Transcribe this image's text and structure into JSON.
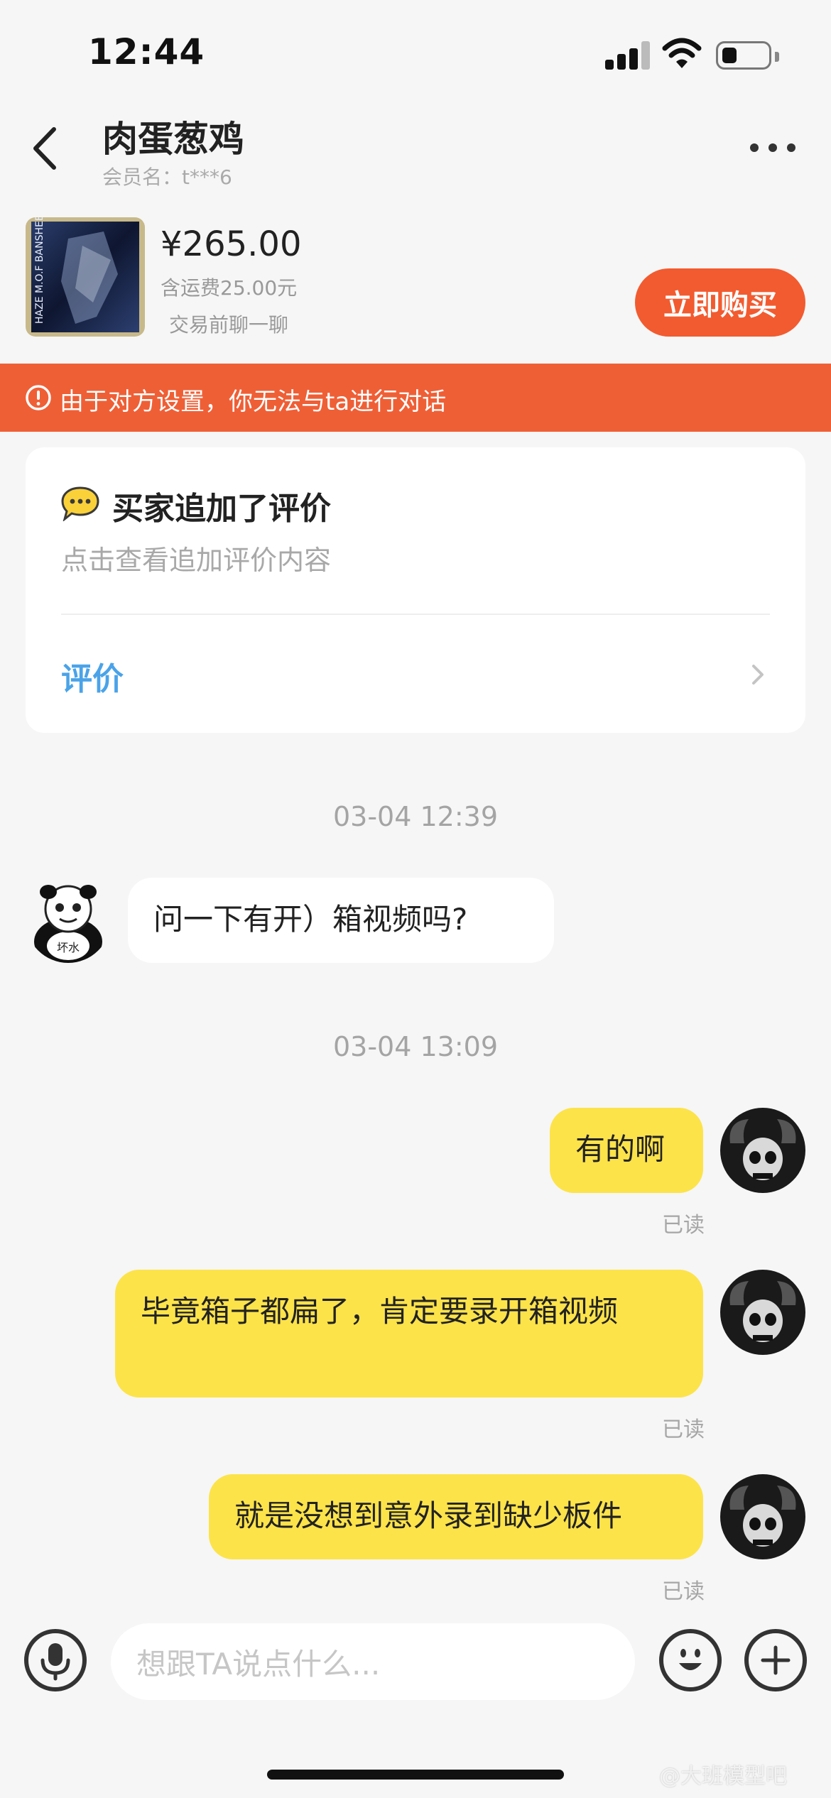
{
  "status_bar": {
    "time": "12:44"
  },
  "header": {
    "title": "肉蛋葱鸡",
    "member_label": "会员名：t***6"
  },
  "product": {
    "price": "¥265.00",
    "shipping": "含运费25.00元",
    "prechat": "交易前聊一聊",
    "buy_label": "立即购买",
    "thumbnail_text": "HAZE M.O.F BANSHEE UNICORN"
  },
  "warning": {
    "text": "由于对方设置，你无法与ta进行对话"
  },
  "review_card": {
    "title": "买家追加了评价",
    "subtitle": "点击查看追加评价内容",
    "link_label": "评价"
  },
  "chat": {
    "timestamps": [
      "03-04 12:39",
      "03-04 13:09"
    ],
    "messages": [
      {
        "side": "left",
        "text": "问一下有开）箱视频吗?"
      },
      {
        "side": "right",
        "text": "有的啊",
        "status": "已读"
      },
      {
        "side": "right",
        "text": "毕竟箱子都扁了，肯定要录开箱视频",
        "status": "已读"
      },
      {
        "side": "right",
        "text": "就是没想到意外录到缺少板件",
        "status": "已读"
      }
    ],
    "left_avatar_text": "坏水"
  },
  "input": {
    "placeholder": "想跟TA说点什么..."
  },
  "watermark": "@大班模型吧",
  "colors": {
    "accent": "#f25b2f",
    "warning_bg": "#ef5f36",
    "self_bubble": "#fce34a",
    "link": "#4aa3e8"
  }
}
